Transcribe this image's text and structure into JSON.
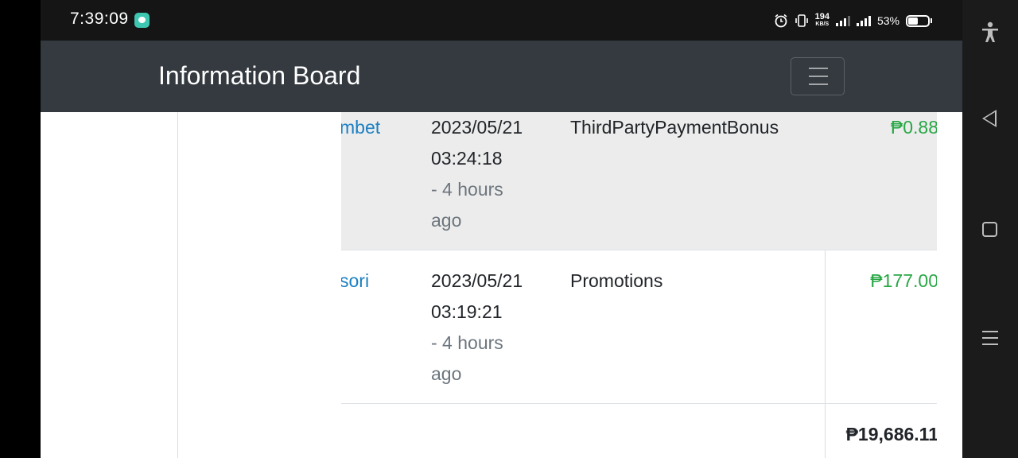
{
  "status_bar": {
    "time": "7:39:09",
    "net_speed_value": "194",
    "net_speed_unit": "KB/S",
    "battery": "53%"
  },
  "navbar": {
    "brand": "Information Board"
  },
  "rows": [
    {
      "user": "mbet",
      "date": "2023/05/21",
      "time": "03:24:18",
      "ago_line1": "- 4 hours",
      "ago_line2": "ago",
      "type": "ThirdPartyPaymentBonus",
      "amount": "₱0.88"
    },
    {
      "user": "sori",
      "date": "2023/05/21",
      "time": "03:19:21",
      "ago_line1": "- 4 hours",
      "ago_line2": "ago",
      "type": "Promotions",
      "amount": "₱177.00"
    }
  ],
  "total": "₱19,686.11",
  "colors": {
    "navbar_bg": "#343a40",
    "link": "#1a7fc1",
    "amount": "#28a745",
    "shaded_row": "#ececec"
  }
}
